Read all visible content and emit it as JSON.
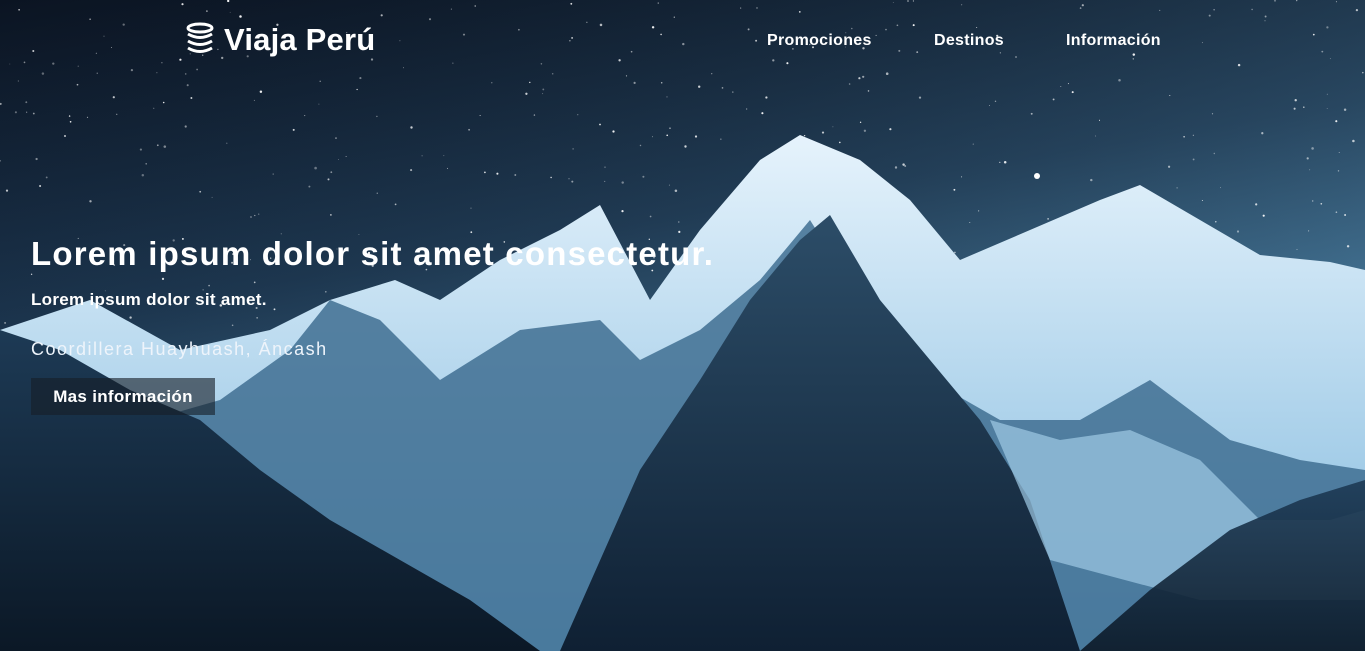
{
  "brand": {
    "name": "Viaja Perú",
    "icon": "stacked-coins-logo-icon"
  },
  "nav": {
    "items": [
      "Promociones",
      "Destinos",
      "Información"
    ]
  },
  "hero": {
    "title": "Lorem ipsum dolor sit amet consectetur.",
    "subtitle": "Lorem ipsum dolor sit amet.",
    "location": "Coordillera Huayhuash, Áncash",
    "cta_label": "Mas información",
    "background": "starry-night-snowy-mountains"
  },
  "colors": {
    "text": "#ffffff",
    "sky_top": "#0b1422",
    "sky_horizon": "#5aa2cf",
    "button_bg": "#161e28"
  }
}
